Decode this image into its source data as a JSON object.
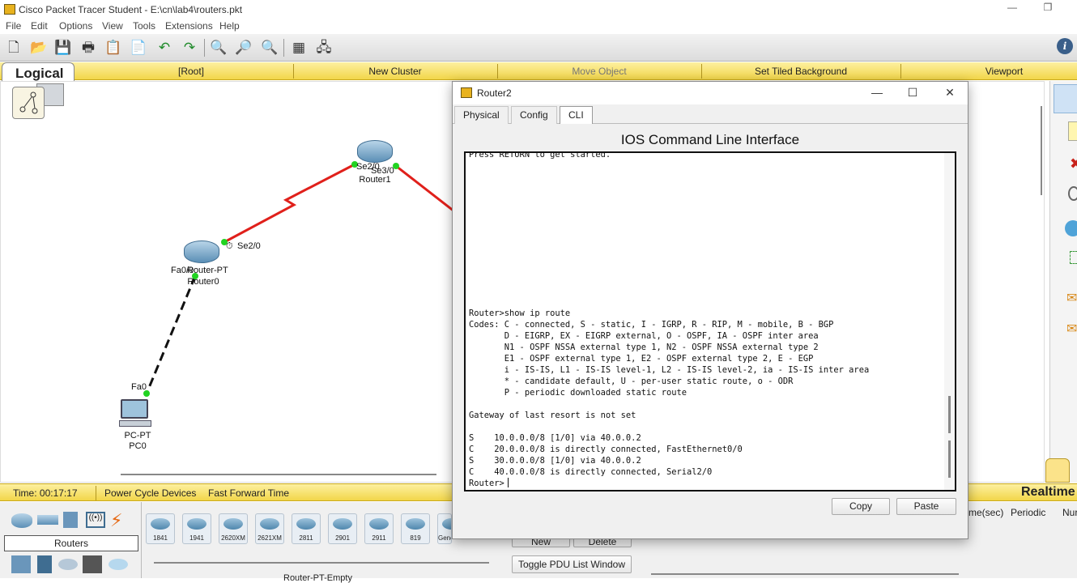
{
  "app": {
    "title": "Cisco Packet Tracer Student - E:\\cn\\lab4\\routers.pkt"
  },
  "menu": [
    "File",
    "Edit",
    "Options",
    "View",
    "Tools",
    "Extensions",
    "Help"
  ],
  "toolbar": {
    "icons": [
      "new-file-icon",
      "open-folder-icon",
      "save-icon",
      "print-icon",
      "activity-wizard-icon",
      "pdu-icon",
      "undo-icon",
      "redo-icon",
      "zoom-in-icon",
      "zoom-reset-icon",
      "zoom-out-icon",
      "palette-icon",
      "custom-device-icon"
    ],
    "info_label": "i"
  },
  "nav": {
    "logical_tab": "Logical",
    "items": [
      "[Root]",
      "New Cluster",
      "Move Object",
      "Set Tiled Background",
      "Viewport"
    ]
  },
  "topology": {
    "router1": {
      "name": "Router1",
      "if_left": "Se2/0",
      "if_right": "Se3/0"
    },
    "router0": {
      "name": "Router0",
      "model": "Router-PT",
      "if_serial": "Se2/0",
      "if_fast": "Fa0/0"
    },
    "pc0": {
      "name": "PC0",
      "model": "PC-PT",
      "if_fast": "Fa0"
    }
  },
  "timebar": {
    "time": "Time: 00:17:17",
    "power_cycle": "Power Cycle Devices",
    "fast_forward": "Fast Forward Time",
    "realtime": "Realtime"
  },
  "bottom": {
    "category_label": "Routers",
    "devices": [
      "1841",
      "1941",
      "2620XM",
      "2621XM",
      "2811",
      "2901",
      "2911",
      "819",
      "Generic"
    ],
    "device_status": "Router-PT-Empty",
    "new_button": "New",
    "delete_button": "Delete",
    "toggle_pdu": "Toggle PDU List Window",
    "col_time": "me(sec)",
    "col_periodic": "Periodic",
    "col_num": "Nur"
  },
  "dialog": {
    "title": "Router2",
    "tabs": [
      "Physical",
      "Config",
      "CLI"
    ],
    "active_tab": "CLI",
    "heading": "IOS Command Line Interface",
    "cli_text": "Press RETURN to get started.\n\n\n\n\n\n\n\n\n\n\n\n\n\nRouter>show ip route\nCodes: C - connected, S - static, I - IGRP, R - RIP, M - mobile, B - BGP\n       D - EIGRP, EX - EIGRP external, O - OSPF, IA - OSPF inter area\n       N1 - OSPF NSSA external type 1, N2 - OSPF NSSA external type 2\n       E1 - OSPF external type 1, E2 - OSPF external type 2, E - EGP\n       i - IS-IS, L1 - IS-IS level-1, L2 - IS-IS level-2, ia - IS-IS inter area\n       * - candidate default, U - per-user static route, o - ODR\n       P - periodic downloaded static route\n\nGateway of last resort is not set\n\nS    10.0.0.0/8 [1/0] via 40.0.0.2\nC    20.0.0.0/8 is directly connected, FastEthernet0/0\nS    30.0.0.0/8 [1/0] via 40.0.0.2\nC    40.0.0.0/8 is directly connected, Serial2/0\nRouter>",
    "copy_button": "Copy",
    "paste_button": "Paste"
  },
  "colors": {
    "serial_link": "#e0201b",
    "nav_yellow": "#f6dd5e",
    "link_dot": "#21d321"
  }
}
